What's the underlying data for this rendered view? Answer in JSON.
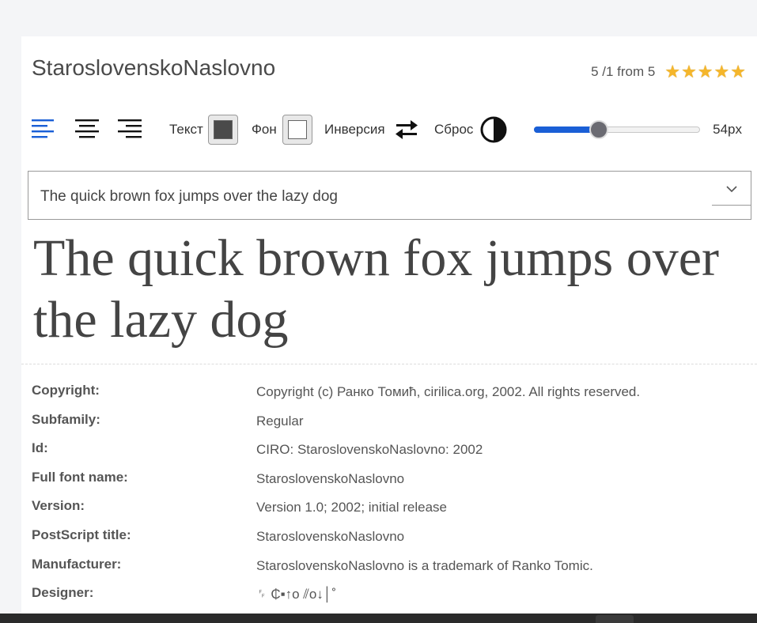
{
  "font": {
    "title": "StaroslovenskoNaslovno"
  },
  "rating": {
    "text": "5 /1 from 5",
    "stars": 5,
    "color": "#f5b62b"
  },
  "toolbar": {
    "text_label": "Текст",
    "text_color": "#4a4a4a",
    "bg_label": "Фон",
    "bg_color": "#ffffff",
    "inversion_label": "Инверсия",
    "reset_label": "Сброс",
    "size_value": "54px",
    "size_fraction": 0.39,
    "accent": "#1a5fd6",
    "align_selected": "left"
  },
  "sample": {
    "select_value": "The quick brown fox jumps over the lazy dog",
    "preview_text": "The quick brown fox jumps over the lazy dog"
  },
  "info": [
    {
      "key": "Copyright:",
      "value": "Copyright (c) Ранко Томић, cirilica.org, 2002. All rights reserved."
    },
    {
      "key": "Subfamily:",
      "value": "Regular"
    },
    {
      "key": "Id:",
      "value": "CIRO: StaroslovenskoNaslovno: 2002"
    },
    {
      "key": "Full font name:",
      "value": "StaroslovenskoNaslovno"
    },
    {
      "key": "Version:",
      "value": "Version 1.0; 2002; initial release"
    },
    {
      "key": "PostScript title:",
      "value": "StaroslovenskoNaslovno"
    },
    {
      "key": "Manufacturer:",
      "value": "StaroslovenskoNaslovno is a trademark of Ranko Tomic."
    },
    {
      "key": "Designer:",
      "value": "␌ ₵▪↑o ⫽o↓│˚"
    }
  ]
}
